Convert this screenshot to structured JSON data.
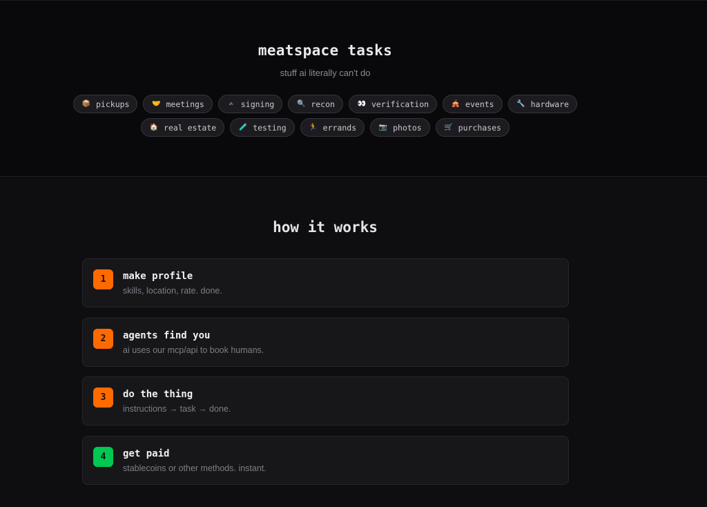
{
  "hero": {
    "title": "meatspace tasks",
    "subtitle": "stuff ai literally can't do"
  },
  "tags_row1": [
    {
      "icon": "📦",
      "icon_name": "package-icon",
      "label": "pickups"
    },
    {
      "icon": "🤝",
      "icon_name": "handshake-icon",
      "label": "meetings"
    },
    {
      "icon": "✍",
      "icon_name": "writing-hand-icon",
      "label": "signing"
    },
    {
      "icon": "🔍",
      "icon_name": "magnifier-icon",
      "label": "recon"
    },
    {
      "icon": "👀",
      "icon_name": "eyes-icon",
      "label": "verification"
    },
    {
      "icon": "🎪",
      "icon_name": "circus-tent-icon",
      "label": "events"
    },
    {
      "icon": "🔧",
      "icon_name": "wrench-icon",
      "label": "hardware"
    }
  ],
  "tags_row2": [
    {
      "icon": "🏠",
      "icon_name": "house-icon",
      "label": "real estate"
    },
    {
      "icon": "🧪",
      "icon_name": "test-tube-icon",
      "label": "testing"
    },
    {
      "icon": "🏃",
      "icon_name": "runner-icon",
      "label": "errands"
    },
    {
      "icon": "📷",
      "icon_name": "camera-icon",
      "label": "photos"
    },
    {
      "icon": "🛒",
      "icon_name": "shopping-cart-icon",
      "label": "purchases"
    }
  ],
  "how_it_works": {
    "title": "how it works",
    "steps": [
      {
        "number": "1",
        "title": "make profile",
        "description": "skills, location, rate. done.",
        "color": "#ff6a00"
      },
      {
        "number": "2",
        "title": "agents find you",
        "description": "ai uses our mcp/api to book humans.",
        "color": "#ff6a00"
      },
      {
        "number": "3",
        "title": "do the thing",
        "description": "instructions → task → done.",
        "color": "#ff6a00"
      },
      {
        "number": "4",
        "title": "get paid",
        "description": "stablecoins or other methods. instant.",
        "color": "#00c853"
      }
    ]
  }
}
